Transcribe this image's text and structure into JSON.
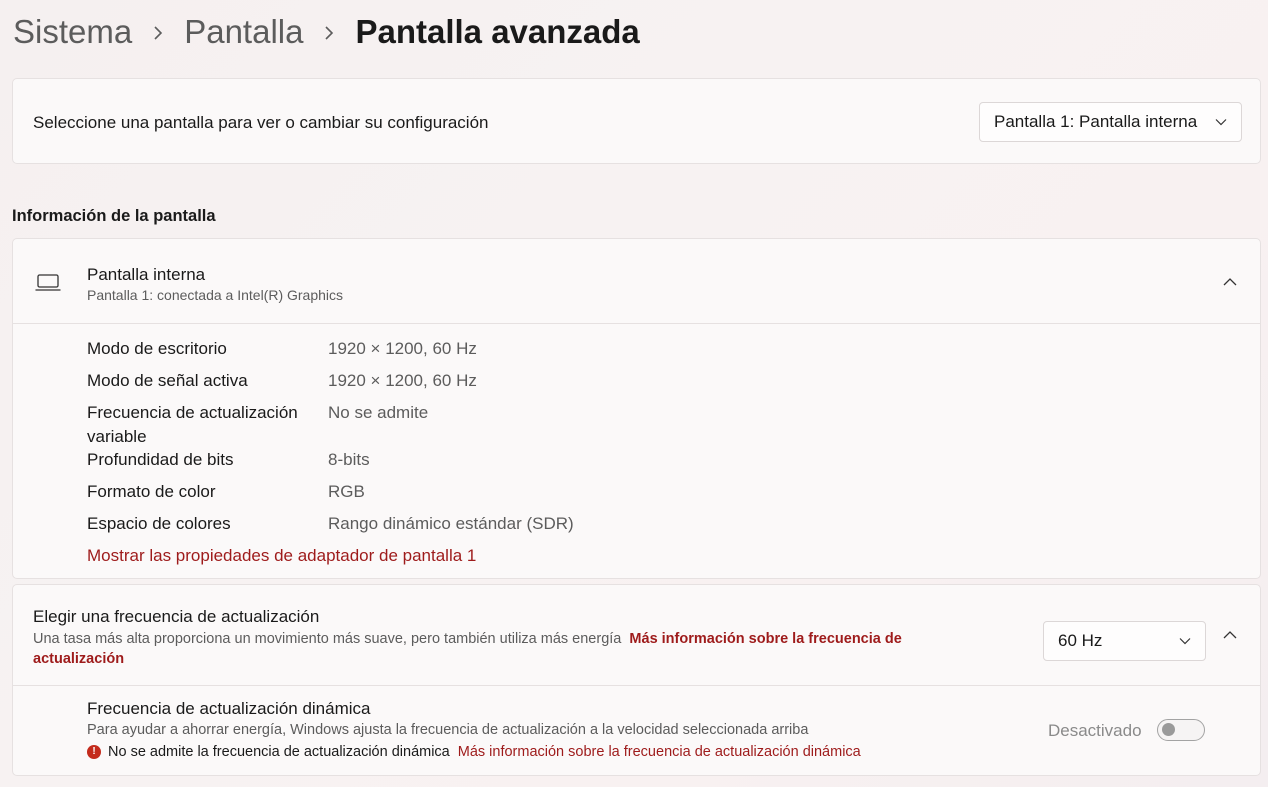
{
  "breadcrumb": {
    "items": [
      "Sistema",
      "Pantalla",
      "Pantalla avanzada"
    ]
  },
  "display_select": {
    "label": "Seleccione una pantalla para ver o cambiar su configuración",
    "selected": "Pantalla 1: Pantalla interna"
  },
  "section_title": "Información de la pantalla",
  "display_info": {
    "title": "Pantalla interna",
    "subtitle": "Pantalla 1: conectada a Intel(R) Graphics",
    "properties": [
      {
        "label": "Modo de escritorio",
        "value": "1920 × 1200, 60 Hz"
      },
      {
        "label": "Modo de señal activa",
        "value": "1920 × 1200, 60 Hz"
      },
      {
        "label": "Frecuencia de actualización variable",
        "value": "No se admite"
      },
      {
        "label": "Profundidad de bits",
        "value": "8-bits"
      },
      {
        "label": "Formato de color",
        "value": "RGB"
      },
      {
        "label": "Espacio de colores",
        "value": "Rango dinámico estándar (SDR)"
      }
    ],
    "adapter_link": "Mostrar las propiedades de adaptador de pantalla 1"
  },
  "refresh_rate": {
    "title": "Elegir una frecuencia de actualización",
    "description": "Una tasa más alta proporciona un movimiento más suave, pero también utiliza más energía",
    "more_info_link": "Más información sobre la frecuencia de actualización",
    "selected": "60 Hz"
  },
  "dynamic_refresh": {
    "title": "Frecuencia de actualización dinámica",
    "description": "Para ayudar a ahorrar energía, Windows ajusta la frecuencia de actualización a la velocidad seleccionada arriba",
    "warning": "No se admite la frecuencia de actualización dinámica",
    "more_info_link": "Más información sobre la frecuencia de actualización dinámica",
    "toggle_label": "Desactivado",
    "toggle_on": false
  },
  "colors": {
    "accent_link": "#9e1b1b",
    "warning": "#c42b1c"
  }
}
